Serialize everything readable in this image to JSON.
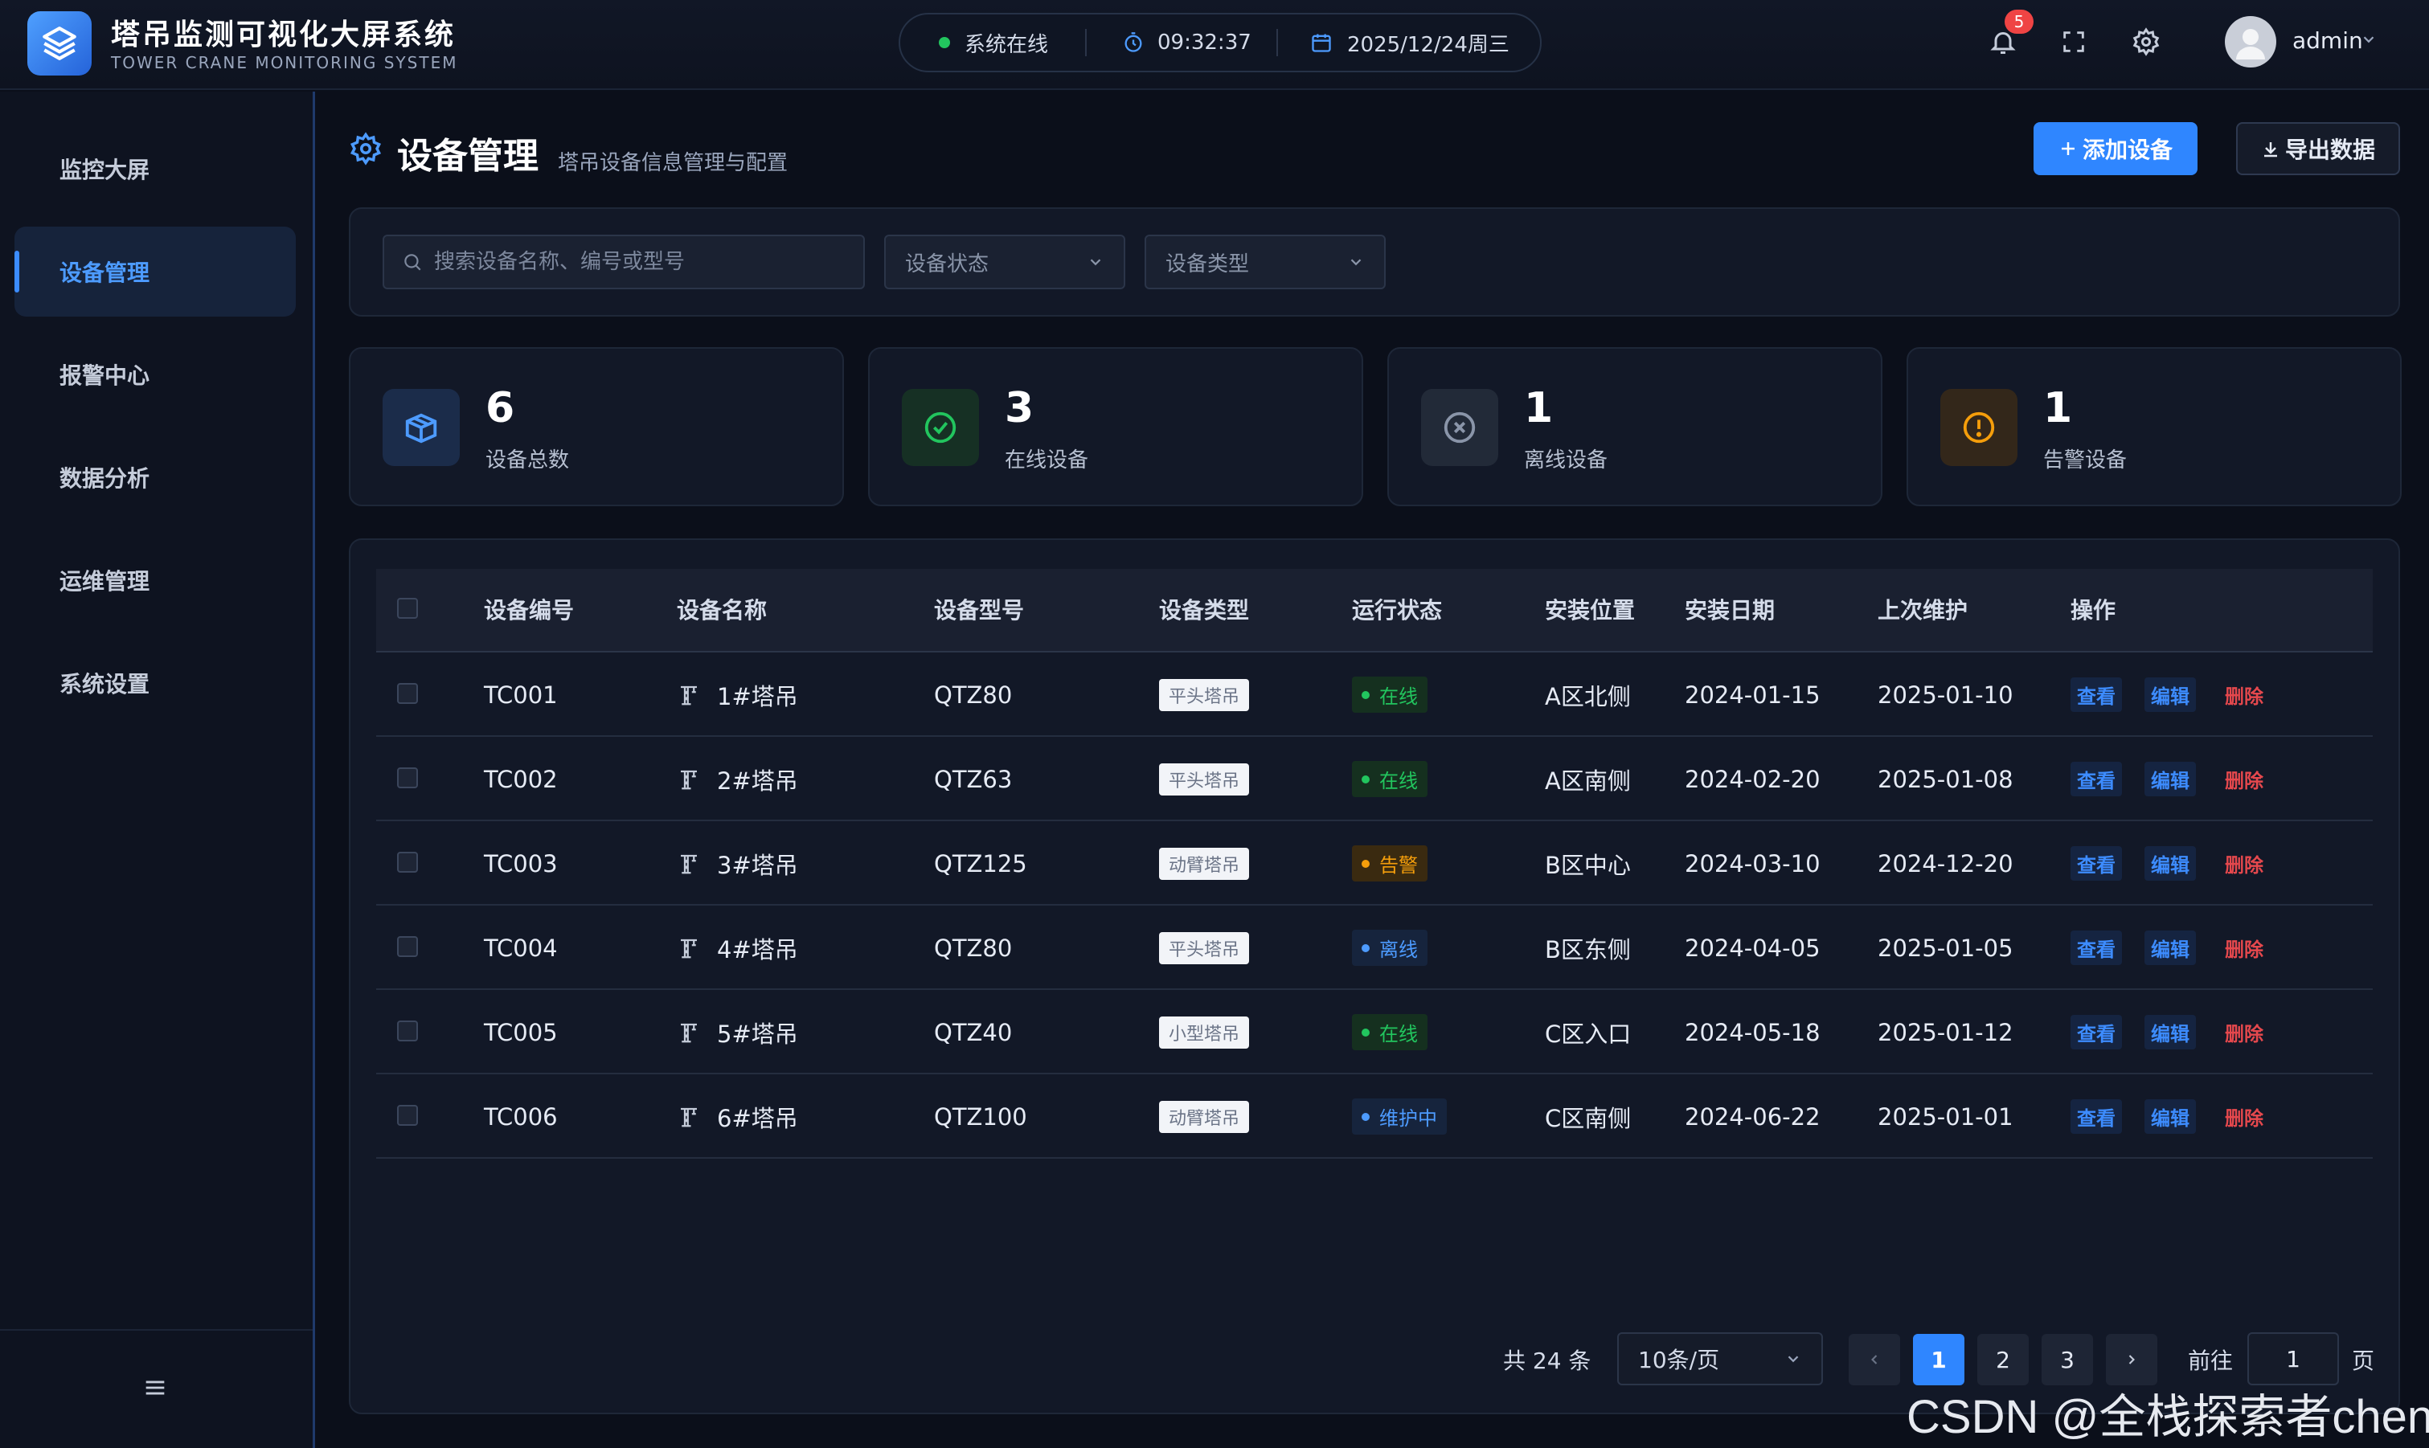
{
  "header": {
    "title": "塔吊监测可视化大屏系统",
    "subtitle": "TOWER CRANE MONITORING SYSTEM",
    "status": "系统在线",
    "time": "09:32:37",
    "date": "2025/12/24周三",
    "notification_count": "5",
    "username": "admin"
  },
  "sidebar": {
    "items": [
      {
        "label": "监控大屏"
      },
      {
        "label": "设备管理"
      },
      {
        "label": "报警中心"
      },
      {
        "label": "数据分析"
      },
      {
        "label": "运维管理"
      },
      {
        "label": "系统设置"
      }
    ],
    "active_index": 1
  },
  "page": {
    "title": "设备管理",
    "subtitle": "塔吊设备信息管理与配置",
    "add_button": "添加设备",
    "export_button": "导出数据"
  },
  "filters": {
    "search_placeholder": "搜索设备名称、编号或型号",
    "status_placeholder": "设备状态",
    "type_placeholder": "设备类型"
  },
  "stats": [
    {
      "value": "6",
      "label": "设备总数",
      "color": "#3d8cff"
    },
    {
      "value": "3",
      "label": "在线设备",
      "color": "#22c55e"
    },
    {
      "value": "1",
      "label": "离线设备",
      "color": "#8a95a9"
    },
    {
      "value": "1",
      "label": "告警设备",
      "color": "#f59e0b"
    }
  ],
  "table": {
    "headers": [
      "设备编号",
      "设备名称",
      "设备型号",
      "设备类型",
      "运行状态",
      "安装位置",
      "安装日期",
      "上次维护",
      "操作"
    ],
    "rows": [
      {
        "id": "TC001",
        "name": "1#塔吊",
        "model": "QTZ80",
        "type": "平头塔吊",
        "status": "在线",
        "location": "A区北侧",
        "install": "2024-01-15",
        "maint": "2025-01-10"
      },
      {
        "id": "TC002",
        "name": "2#塔吊",
        "model": "QTZ63",
        "type": "平头塔吊",
        "status": "在线",
        "location": "A区南侧",
        "install": "2024-02-20",
        "maint": "2025-01-08"
      },
      {
        "id": "TC003",
        "name": "3#塔吊",
        "model": "QTZ125",
        "type": "动臂塔吊",
        "status": "告警",
        "location": "B区中心",
        "install": "2024-03-10",
        "maint": "2024-12-20"
      },
      {
        "id": "TC004",
        "name": "4#塔吊",
        "model": "QTZ80",
        "type": "平头塔吊",
        "status": "离线",
        "location": "B区东侧",
        "install": "2024-04-05",
        "maint": "2025-01-05"
      },
      {
        "id": "TC005",
        "name": "5#塔吊",
        "model": "QTZ40",
        "type": "小型塔吊",
        "status": "在线",
        "location": "C区入口",
        "install": "2024-05-18",
        "maint": "2025-01-12"
      },
      {
        "id": "TC006",
        "name": "6#塔吊",
        "model": "QTZ100",
        "type": "动臂塔吊",
        "status": "维护中",
        "location": "C区南侧",
        "install": "2024-06-22",
        "maint": "2025-01-01"
      }
    ],
    "actions": {
      "view": "查看",
      "edit": "编辑",
      "delete": "删除"
    },
    "status_colors": {
      "在线": {
        "fg": "#22c55e",
        "bg": "#15301f"
      },
      "告警": {
        "fg": "#f59e0b",
        "bg": "#3a2a10"
      },
      "离线": {
        "fg": "#4d9bff",
        "bg": "#16243d"
      },
      "维护中": {
        "fg": "#4d9bff",
        "bg": "#16243d"
      }
    }
  },
  "pagination": {
    "total": "共 24 条",
    "page_size": "10条/页",
    "pages": [
      "1",
      "2",
      "3"
    ],
    "current": "1",
    "goto_label": "前往",
    "goto_value": "1",
    "page_suffix": "页"
  },
  "watermark": {
    "bottom_text": "CSDN @全栈探索者chen"
  }
}
